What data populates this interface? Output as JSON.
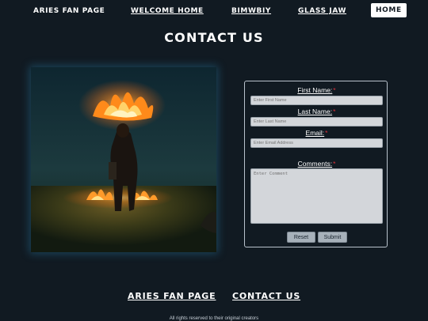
{
  "nav": {
    "items": [
      {
        "label": "ARIES FAN PAGE"
      },
      {
        "label": "WELCOME HOME"
      },
      {
        "label": "BIMWBIY"
      },
      {
        "label": "GLASS JAW"
      },
      {
        "label": "HOME"
      }
    ]
  },
  "page": {
    "title": "CONTACT US"
  },
  "form": {
    "first_name": {
      "label": "First Name:",
      "required": "*",
      "placeholder": "Enter First Name"
    },
    "last_name": {
      "label": "Last Name:",
      "required": "*",
      "placeholder": "Enter Last Name"
    },
    "email": {
      "label": "Email:",
      "required": "*",
      "placeholder": "Enter Email Address"
    },
    "comments": {
      "label": "Comments:",
      "required": "*",
      "placeholder": "Enter Comment"
    },
    "reset_label": "Reset",
    "submit_label": "Submit"
  },
  "footer": {
    "links": [
      {
        "label": "ARIES FAN PAGE"
      },
      {
        "label": "CONTACT US"
      }
    ],
    "copyright": "All rights reserved to their original creators"
  },
  "colors": {
    "background": "#111a22",
    "required": "#e0303a",
    "input_bg": "#d3d6da"
  }
}
